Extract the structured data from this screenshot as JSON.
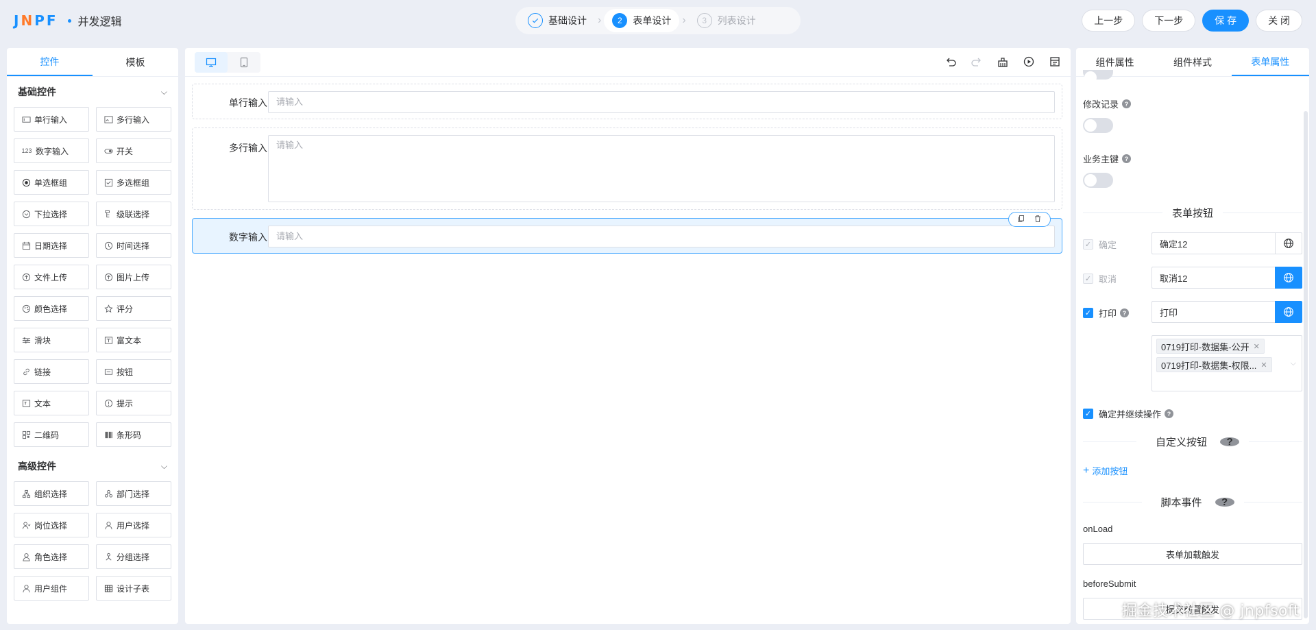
{
  "header": {
    "logo_text": "JNPF",
    "app_title": "并发逻辑",
    "steps": [
      {
        "number": "1",
        "label": "基础设计"
      },
      {
        "number": "2",
        "label": "表单设计"
      },
      {
        "number": "3",
        "label": "列表设计"
      }
    ],
    "buttons": {
      "prev": "上一步",
      "next": "下一步",
      "save": "保 存",
      "close": "关 闭"
    }
  },
  "left_panel": {
    "tabs": [
      "控件",
      "模板"
    ],
    "basic_group": {
      "title": "基础控件",
      "items": [
        {
          "label": "单行输入",
          "icon": "input-icon"
        },
        {
          "label": "多行输入",
          "icon": "textarea-icon"
        },
        {
          "label": "数字输入",
          "icon": "number-icon"
        },
        {
          "label": "开关",
          "icon": "switch-icon"
        },
        {
          "label": "单选框组",
          "icon": "radio-icon"
        },
        {
          "label": "多选框组",
          "icon": "checkbox-icon"
        },
        {
          "label": "下拉选择",
          "icon": "select-icon"
        },
        {
          "label": "级联选择",
          "icon": "cascader-icon"
        },
        {
          "label": "日期选择",
          "icon": "date-icon"
        },
        {
          "label": "时间选择",
          "icon": "time-icon"
        },
        {
          "label": "文件上传",
          "icon": "upload-icon"
        },
        {
          "label": "图片上传",
          "icon": "image-upload-icon"
        },
        {
          "label": "颜色选择",
          "icon": "palette-icon"
        },
        {
          "label": "评分",
          "icon": "star-icon"
        },
        {
          "label": "滑块",
          "icon": "slider-icon"
        },
        {
          "label": "富文本",
          "icon": "rich-text-icon"
        },
        {
          "label": "链接",
          "icon": "link-icon"
        },
        {
          "label": "按钮",
          "icon": "button-icon"
        },
        {
          "label": "文本",
          "icon": "text-icon"
        },
        {
          "label": "提示",
          "icon": "alert-icon"
        },
        {
          "label": "二维码",
          "icon": "qrcode-icon"
        },
        {
          "label": "条形码",
          "icon": "barcode-icon"
        }
      ]
    },
    "advanced_group": {
      "title": "高级控件",
      "items": [
        {
          "label": "组织选择",
          "icon": "org-icon"
        },
        {
          "label": "部门选择",
          "icon": "department-icon"
        },
        {
          "label": "岗位选择",
          "icon": "position-icon"
        },
        {
          "label": "用户选择",
          "icon": "user-icon"
        },
        {
          "label": "角色选择",
          "icon": "role-icon"
        },
        {
          "label": "分组选择",
          "icon": "group-icon"
        },
        {
          "label": "用户组件",
          "icon": "user-component-icon"
        },
        {
          "label": "设计子表",
          "icon": "table-icon"
        }
      ]
    }
  },
  "canvas": {
    "fields": [
      {
        "label": "单行输入",
        "placeholder": "请输入"
      },
      {
        "label": "多行输入",
        "placeholder": "请输入"
      },
      {
        "label": "数字输入",
        "placeholder": "请输入"
      }
    ]
  },
  "right_panel": {
    "tabs": [
      "组件属性",
      "组件样式",
      "表单属性"
    ],
    "modify_record_label": "修改记录",
    "business_key_label": "业务主键",
    "form_buttons_title": "表单按钮",
    "confirm": {
      "label": "确定",
      "value": "确定12"
    },
    "cancel": {
      "label": "取消",
      "value": "取消12"
    },
    "print": {
      "label": "打印",
      "value": "打印"
    },
    "print_templates": [
      "0719打印-数据集-公开",
      "0719打印-数据集-权限..."
    ],
    "confirm_continue_label": "确定并继续操作",
    "custom_buttons_title": "自定义按钮",
    "add_button_label": "添加按钮",
    "script_events_title": "脚本事件",
    "events": [
      {
        "name": "onLoad",
        "button": "表单加载触发"
      },
      {
        "name": "beforeSubmit",
        "button": "提交前置触发"
      }
    ]
  },
  "watermark": "掘金技术社区 @ jnpfsoft",
  "colors": {
    "primary": "#1890ff",
    "background": "#ebeef5"
  }
}
